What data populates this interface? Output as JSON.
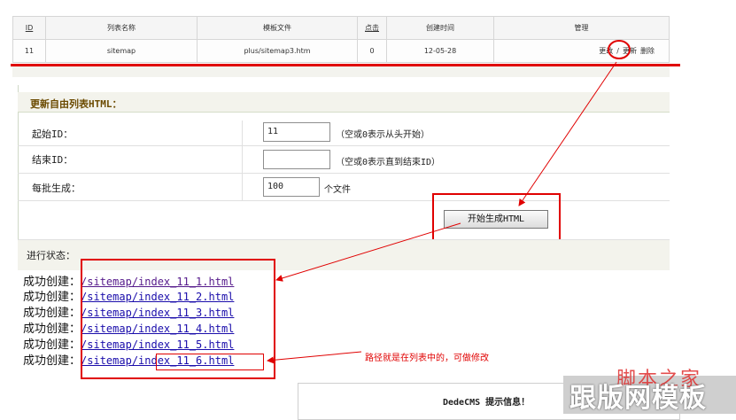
{
  "list_table": {
    "headers": [
      "ID",
      "列表名称",
      "模板文件",
      "点击",
      "创建时间",
      "管理"
    ],
    "row": {
      "id": "11",
      "name": "sitemap",
      "template": "plus/sitemap3.htm",
      "clicks": "0",
      "created": "12-05-28",
      "actions": [
        "更改",
        "更新",
        "删除"
      ],
      "separator": "/"
    }
  },
  "form": {
    "title": "更新自由列表HTML：",
    "start_id": {
      "label": "起始ID：",
      "value": "11",
      "hint": "（空或0表示从头开始）"
    },
    "end_id": {
      "label": "结束ID：",
      "value": "",
      "hint": "（空或0表示直到结束ID）"
    },
    "batch": {
      "label": "每批生成：",
      "value": "100",
      "unit": "个文件"
    },
    "submit_label": "开始生成HTML",
    "status_label": "进行状态："
  },
  "results": {
    "prefix": "成功创建：",
    "links": [
      "/sitemap/index_11_1.html",
      "/sitemap/index_11_2.html",
      "/sitemap/index_11_3.html",
      "/sitemap/index_11_4.html",
      "/sitemap/index_11_5.html",
      "/sitemap/index_11_6.html"
    ]
  },
  "annotation": "路径就是在列表中的，可做修改",
  "notice_title": "DedeCMS 提示信息！",
  "watermark": {
    "main": "跟版网模板",
    "overlay": "脚本之家"
  },
  "colors": {
    "annotation_red": "#e00000",
    "link_blue": "#1a0dab",
    "panel_bg": "#f3f3ec"
  }
}
